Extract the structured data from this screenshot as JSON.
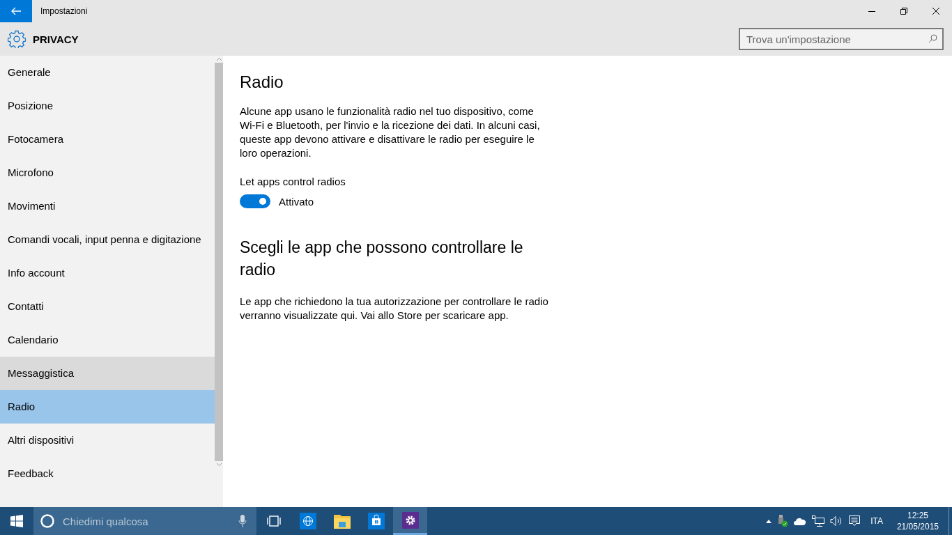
{
  "window": {
    "title": "Impostazioni"
  },
  "header": {
    "title": "PRIVACY",
    "search": {
      "placeholder": "Trova un'impostazione"
    }
  },
  "sidebar": {
    "items": [
      {
        "label": "Generale",
        "selected": false,
        "hovered": false
      },
      {
        "label": "Posizione",
        "selected": false,
        "hovered": false
      },
      {
        "label": "Fotocamera",
        "selected": false,
        "hovered": false
      },
      {
        "label": "Microfono",
        "selected": false,
        "hovered": false
      },
      {
        "label": "Movimenti",
        "selected": false,
        "hovered": false
      },
      {
        "label": "Comandi vocali, input penna e digitazione",
        "selected": false,
        "hovered": false
      },
      {
        "label": "Info account",
        "selected": false,
        "hovered": false
      },
      {
        "label": "Contatti",
        "selected": false,
        "hovered": false
      },
      {
        "label": "Calendario",
        "selected": false,
        "hovered": false
      },
      {
        "label": "Messaggistica",
        "selected": false,
        "hovered": true
      },
      {
        "label": "Radio",
        "selected": true,
        "hovered": false
      },
      {
        "label": "Altri dispositivi",
        "selected": false,
        "hovered": false
      },
      {
        "label": "Feedback",
        "selected": false,
        "hovered": false
      }
    ]
  },
  "content": {
    "title": "Radio",
    "description": "Alcune app usano le funzionalità radio nel tuo dispositivo, come Wi-Fi e Bluetooth, per l'invio e la ricezione dei dati. In alcuni casi, queste app devono attivare e disattivare le radio per eseguire le loro operazioni.",
    "toggle": {
      "label": "Let apps control radios",
      "on": true,
      "state_text": "Attivato"
    },
    "section_title": "Scegli le app che possono controllare le radio",
    "section_text": "Le app che richiedono la tua autorizzazione per controllare le radio verranno visualizzate qui. Vai allo Store per scaricare app."
  },
  "taskbar": {
    "search": {
      "placeholder": "Chiedimi qualcosa"
    },
    "apps": [
      {
        "kind": "taskview",
        "selected": false
      },
      {
        "kind": "browser",
        "selected": false
      },
      {
        "kind": "explorer",
        "selected": false
      },
      {
        "kind": "store",
        "selected": false
      },
      {
        "kind": "settings",
        "selected": true
      }
    ],
    "language": "ITA",
    "time": "12:25",
    "date": "21/05/2015"
  }
}
